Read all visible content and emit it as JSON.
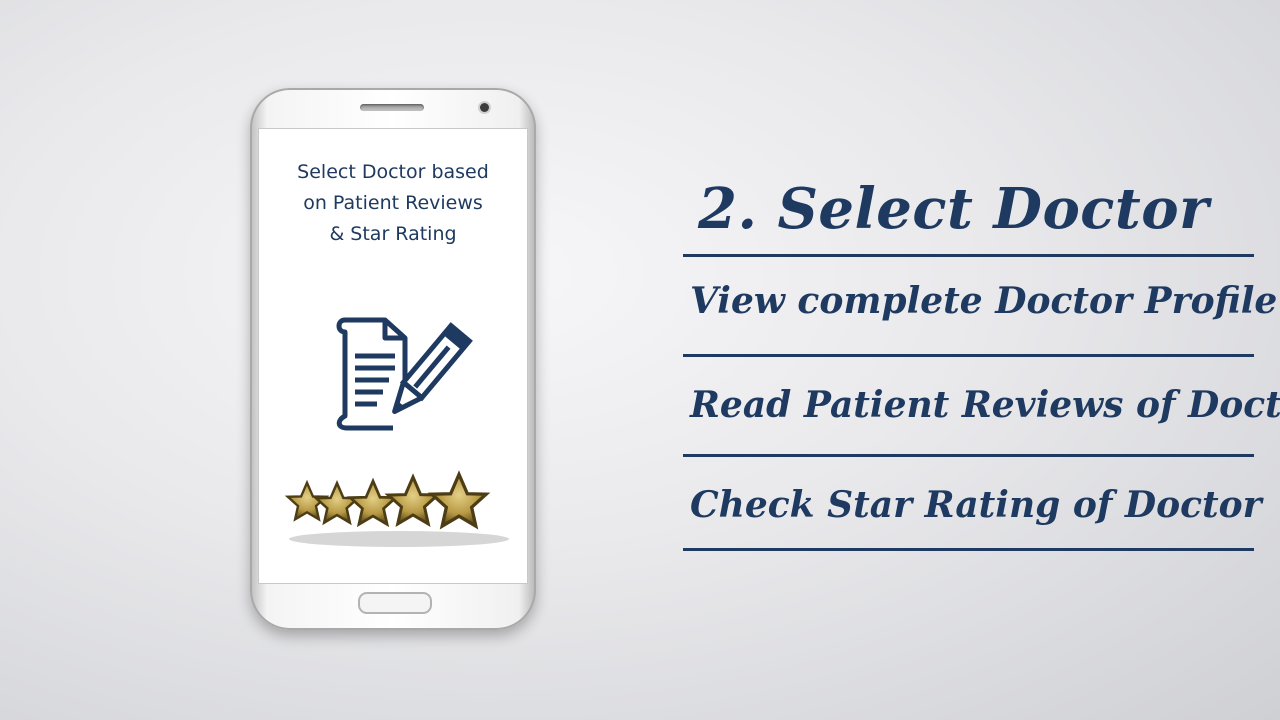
{
  "phone": {
    "screen_title_lines": [
      "Select Doctor based",
      "on Patient Reviews",
      "& Star Rating"
    ],
    "document_icon": "document-with-pencil-icon",
    "rating": {
      "stars": 5,
      "icon": "gold-star-icon"
    }
  },
  "heading": "2. Select Doctor",
  "items": [
    "View complete Doctor Profile",
    "Read Patient Reviews of Doctor",
    "Check Star Rating of Doctor"
  ],
  "colors": {
    "text": "#1f3a60",
    "rule": "#1f3a60",
    "star_gold": "#b89a45",
    "star_dark": "#5d4a1d"
  }
}
